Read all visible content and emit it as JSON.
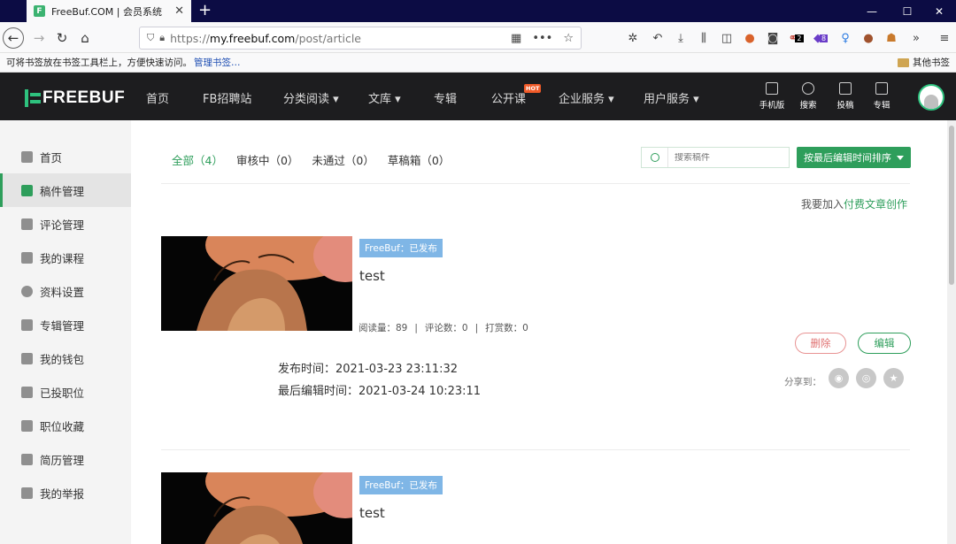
{
  "browser": {
    "tab_title": "FreeBuf.COM | 会员系统",
    "tab_favicon": "F",
    "url_proto": "https://",
    "url_host": "my.freebuf.com",
    "url_path": "/post/article",
    "bookmark_tip": "可将书签放在书签工具栏上，方便快速访问。",
    "bookmark_link": "管理书签…",
    "other_bookmarks": "其他书签",
    "badge_one": "2",
    "badge_two": "8"
  },
  "site": {
    "logo_text": "FREEBUF",
    "brand_color": "#2e9e5b",
    "nav": [
      "首页",
      "FB招聘站",
      "分类阅读 ▾",
      "文库 ▾",
      "专辑",
      "公开课",
      "企业服务 ▾",
      "用户服务 ▾"
    ],
    "hot_badge": "HOT",
    "tools": [
      "手机版",
      "搜索",
      "投稿",
      "专辑"
    ]
  },
  "sidebar": {
    "items": [
      "首页",
      "稿件管理",
      "评论管理",
      "我的课程",
      "资料设置",
      "专辑管理",
      "我的钱包",
      "已投职位",
      "职位收藏",
      "简历管理",
      "我的举报"
    ],
    "active_index": 1
  },
  "filters": {
    "all": "全部（4）",
    "reviewing": "审核中（0）",
    "rejected": "未通过（0）",
    "drafts": "草稿箱（0）"
  },
  "search": {
    "placeholder": "搜索稿件"
  },
  "sort": {
    "label": "按最后编辑时间排序"
  },
  "join": {
    "prefix": "我要加入",
    "link": "付费文章创作"
  },
  "articles": [
    {
      "status": "FreeBuf：已发布",
      "title": "test",
      "reads_label": "阅读量：89",
      "comments_label": "评论数：0",
      "rewards_label": "打赏数：0",
      "published": "发布时间：2021-03-23 23:11:32",
      "edited": "最后编辑时间：2021-03-24 10:23:11",
      "delete_label": "删除",
      "edit_label": "编辑",
      "share_label": "分享到："
    },
    {
      "status": "FreeBuf：已发布",
      "title": "test"
    }
  ],
  "separator": "|"
}
